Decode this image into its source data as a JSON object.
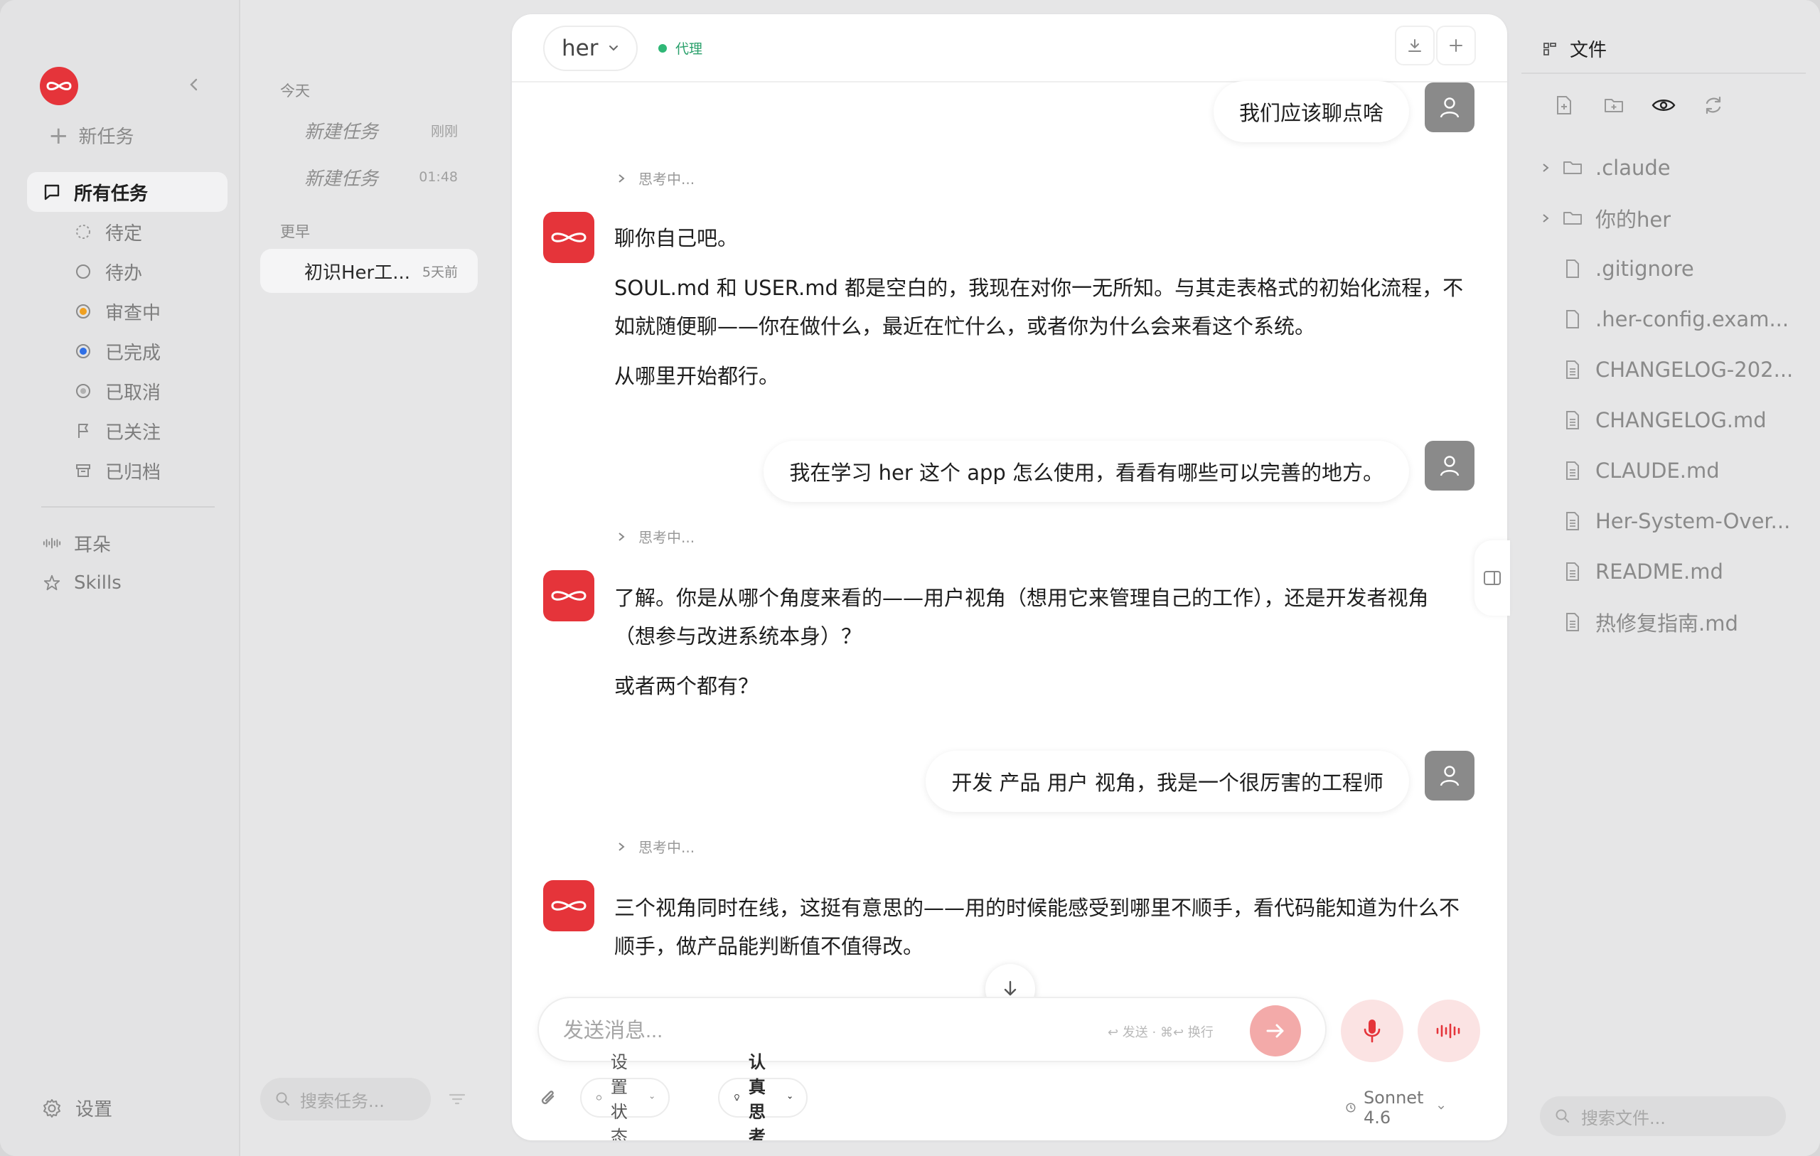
{
  "sidebar": {
    "new_task": "新任务",
    "nav": [
      {
        "label": "所有任务",
        "icon": "chat-bubble-icon",
        "active": true
      },
      {
        "label": "待定",
        "icon": "dashed-circle-icon"
      },
      {
        "label": "待办",
        "icon": "circle-icon"
      },
      {
        "label": "审查中",
        "icon": "orange-dot-circle-icon"
      },
      {
        "label": "已完成",
        "icon": "blue-dot-circle-icon"
      },
      {
        "label": "已取消",
        "icon": "gray-dot-circle-icon"
      },
      {
        "label": "已关注",
        "icon": "flag-icon"
      },
      {
        "label": "已归档",
        "icon": "archive-icon"
      }
    ],
    "extra": [
      {
        "label": "耳朵",
        "icon": "waveform-icon"
      },
      {
        "label": "Skills",
        "icon": "star-icon"
      }
    ],
    "settings": "设置"
  },
  "tasks": {
    "today_label": "今天",
    "earlier_label": "更早",
    "today": [
      {
        "name": "新建任务",
        "time": "刚刚"
      },
      {
        "name": "新建任务",
        "time": "01:48"
      }
    ],
    "earlier": [
      {
        "name": "初识Her工...",
        "time": "5天前"
      }
    ],
    "search_placeholder": "搜索任务..."
  },
  "chat": {
    "agent": "her",
    "status": "代理",
    "messages": {
      "u1": "我们应该聊点啥",
      "think1": "思考中...",
      "b1": [
        "聊你自己吧。",
        "SOUL.md 和 USER.md 都是空白的，我现在对你一无所知。与其走表格式的初始化流程，不如就随便聊——你在做什么，最近在忙什么，或者你为什么会来看这个系统。",
        "从哪里开始都行。"
      ],
      "u2": "我在学习 her 这个 app 怎么使用，看看有哪些可以完善的地方。",
      "think2": "思考中...",
      "b2": [
        "了解。你是从哪个角度来看的——用户视角（想用它来管理自己的工作），还是开发者视角（想参与改进系统本身）？",
        "或者两个都有？"
      ],
      "u3": "开发 产品 用户 视角，我是一个很厉害的工程师",
      "think3": "思考中...",
      "b3": [
        "三个视角同时在线，这挺有意思的——用的时候能感受到哪里不顺手，看代码能知道为什么不顺手，做产品能判断值不值得改。"
      ]
    },
    "composer": {
      "placeholder": "发送消息...",
      "hint": "↩ 发送 · ⌘↩ 换行"
    },
    "status_pill": "设置状态",
    "think_pill": "认真思考",
    "model": "Sonnet 4.6",
    "accent": "#e5343a"
  },
  "files": {
    "title": "文件",
    "folders": [
      ".claude",
      "你的her"
    ],
    "items": [
      ".gitignore",
      ".her-config.exam...",
      "CHANGELOG-202...",
      "CHANGELOG.md",
      "CLAUDE.md",
      "Her-System-Over...",
      "README.md",
      "热修复指南.md"
    ],
    "search_placeholder": "搜索文件..."
  }
}
